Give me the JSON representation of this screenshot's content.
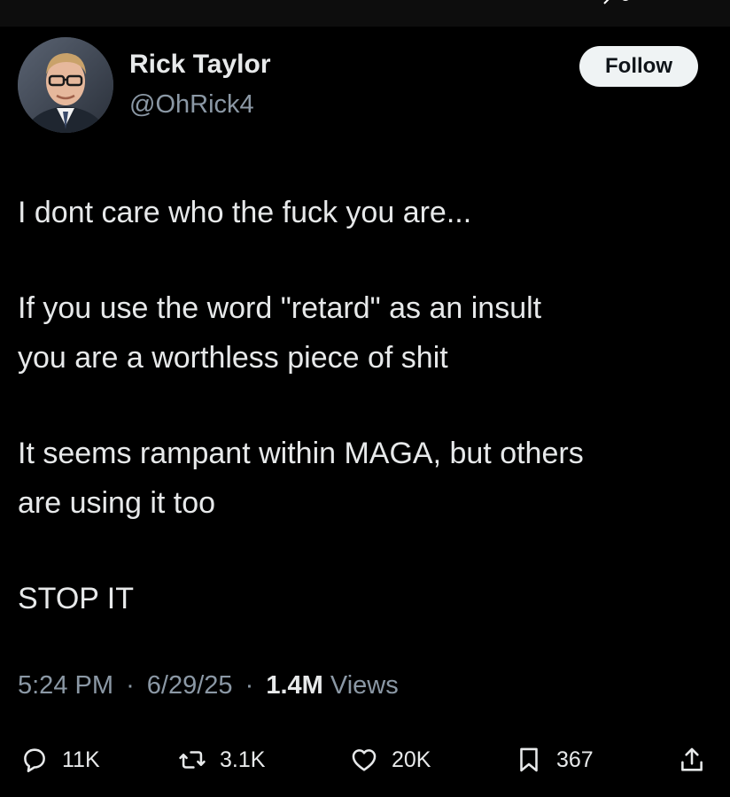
{
  "tweet": {
    "author": {
      "name": "Rick Taylor",
      "handle": "@OhRick4"
    },
    "follow_label": "Follow",
    "paragraphs": [
      "I dont care who the fuck you are...",
      "If you use the word \"retard\" as an insult\nyou are a worthless piece of shit",
      "It seems rampant within MAGA, but others\nare using it too",
      "STOP IT"
    ],
    "time": "5:24 PM",
    "date": "6/29/25",
    "separator": "·",
    "views_count": "1.4M",
    "views_label": "Views",
    "actions": {
      "reply_count": "11K",
      "retweet_count": "3.1K",
      "like_count": "20K",
      "bookmark_count": "367"
    }
  },
  "icons": {
    "reply": "speech-bubble",
    "retweet": "two-arrows-loop",
    "like": "heart",
    "bookmark": "bookmark",
    "share": "upload-arrow"
  },
  "colors": {
    "background": "#000000",
    "text": "#e7e9ea",
    "secondary_text": "#8b98a5",
    "follow_button": "#eff3f4"
  }
}
